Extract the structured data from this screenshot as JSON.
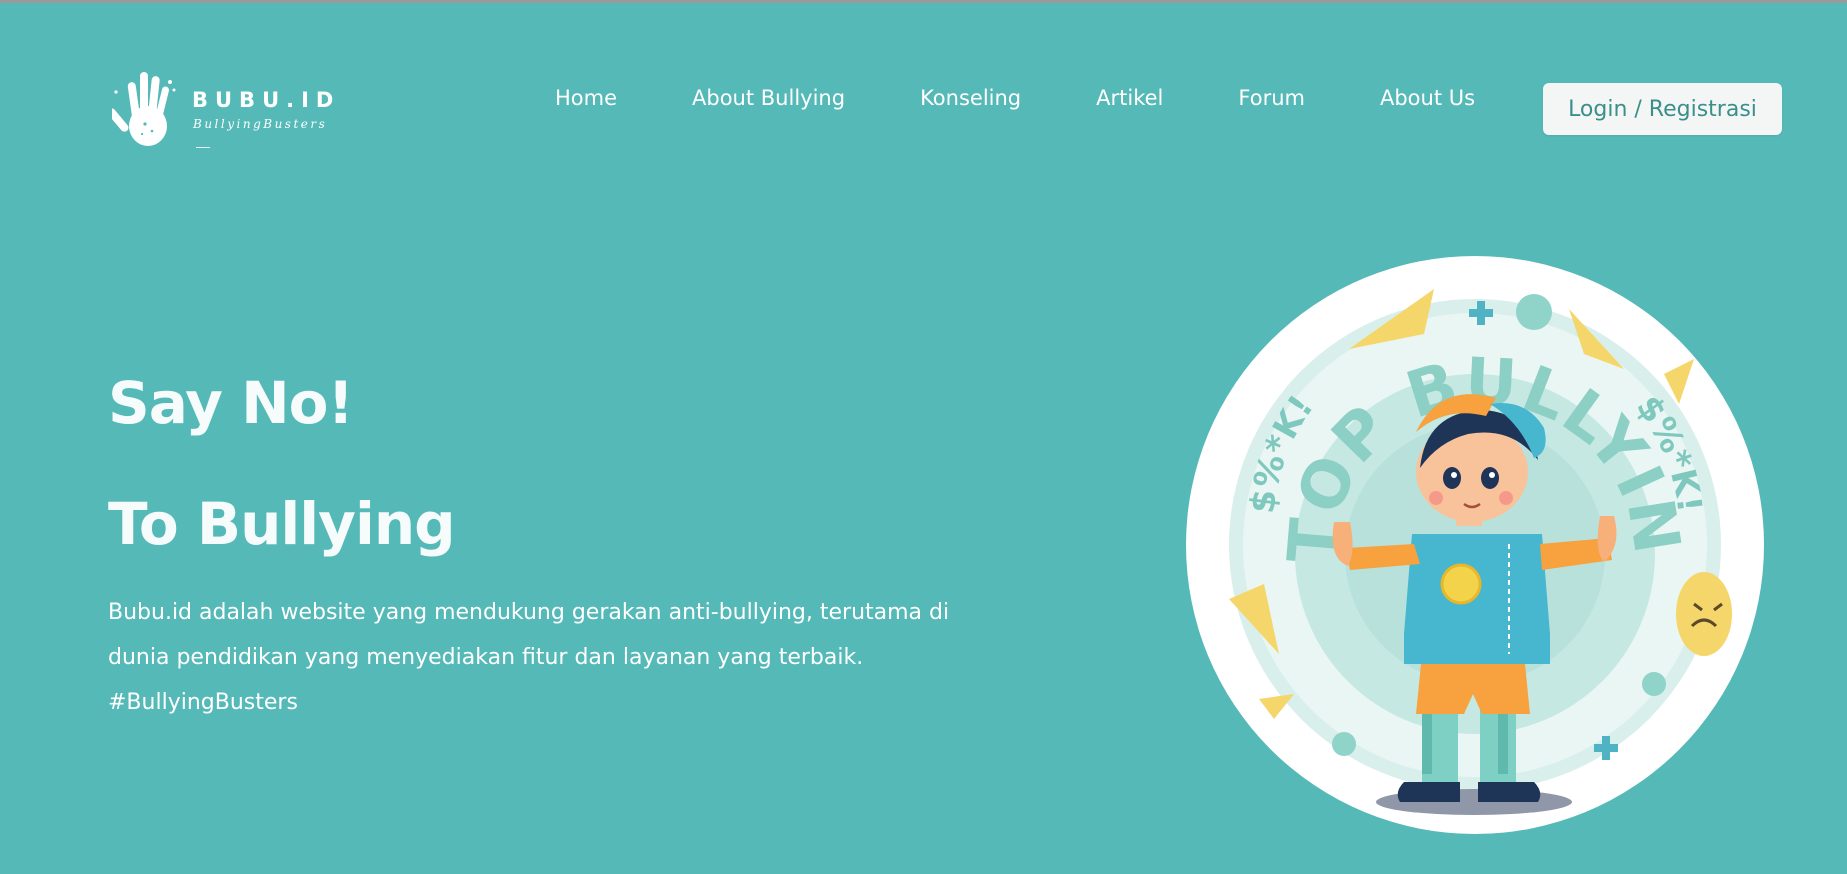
{
  "brand": {
    "name": "BUBU.ID",
    "tagline": "BullyingBusters"
  },
  "nav": {
    "items": [
      {
        "label": "Home"
      },
      {
        "label": "About Bullying"
      },
      {
        "label": "Konseling"
      },
      {
        "label": "Artikel"
      },
      {
        "label": "Forum"
      },
      {
        "label": "About Us"
      }
    ],
    "login_label": "Login / Registrasi"
  },
  "hero": {
    "title_line1": "Say No!",
    "title_line2": "To Bullying",
    "desc_line1": "Bubu.id adalah website yang mendukung gerakan anti-bullying, terutama di",
    "desc_line2": "dunia pendidikan yang menyediakan fitur dan layanan yang terbaik.",
    "desc_line3": "#BullyingBusters"
  },
  "illustration": {
    "arc_text": "STOP BULLYING",
    "side_text": "$%*K!",
    "colors": {
      "background": "#55b9b8",
      "accent": "#3b8f8a",
      "yellow": "#f5d66a",
      "orange": "#f8a13f"
    }
  }
}
